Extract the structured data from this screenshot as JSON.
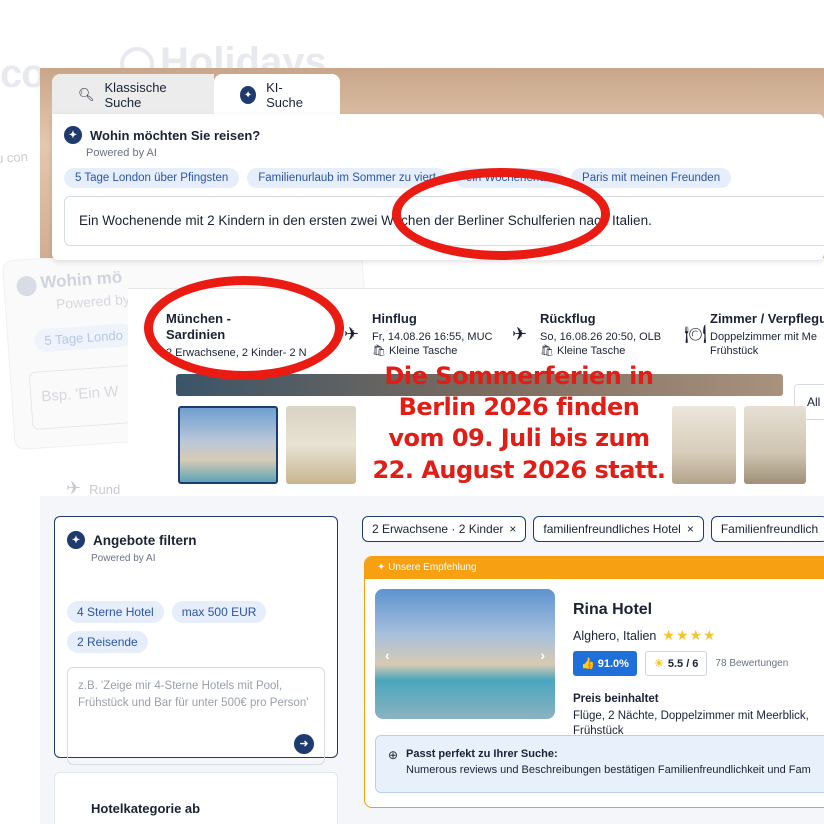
{
  "background": {
    "logo_left": "co",
    "logo_main": "Holidays",
    "side_text": "u con",
    "card_title": "Wohin mö",
    "card_sub": "Powered by",
    "card_chip": "5 Tage Londo",
    "card_input": "Bsp. 'Ein W",
    "rund_text": "Rund"
  },
  "search_tabs": [
    {
      "label": "Klassische Suche",
      "icon": "search-icon"
    },
    {
      "label": "KI-Suche",
      "icon": "ai-sparkle-icon"
    }
  ],
  "ai_search": {
    "title": "Wohin möchten Sie reisen?",
    "subtitle": "Powered by AI",
    "suggestions": [
      "5 Tage London über Pfingsten",
      "Familienurlaub im Sommer zu viert",
      "ein Wochenende",
      "Paris mit meinen Freunden"
    ],
    "query": "Ein Wochenende mit 2 Kindern in den ersten zwei Wochen der Berliner Schulferien nach Italien."
  },
  "trip": {
    "route": "München - Sardinien",
    "travellers": "2 Erwachsene, 2 Kinder- 2 N",
    "outbound": {
      "title": "Hinflug",
      "time": "Fr, 14.08.26 16:55, MUC",
      "baggage": "Kleine Tasche"
    },
    "return": {
      "title": "Rückflug",
      "time": "So, 16.08.26 20:50, OLB",
      "baggage": "Kleine Tasche"
    },
    "room": {
      "title": "Zimmer / Verpflegu",
      "text": "Doppelzimmer mit Me Frühstück"
    },
    "all_button": "All"
  },
  "annotation": "Die Sommerferien in Berlin 2026 finden vom 09. Juli bis zum 22. August 2026 statt.",
  "filter_panel": {
    "title": "Angebote filtern",
    "subtitle": "Powered by AI",
    "chips": [
      "4 Sterne Hotel",
      "max 500 EUR",
      "2 Reisende"
    ],
    "placeholder": "z.B. 'Zeige mir 4-Sterne Hotels mit Pool, Frühstück und Bar für unter 500€ pro Person'",
    "category_title": "Hotelkategorie ab"
  },
  "active_filters": [
    "2 Erwachsene · 2 Kinder",
    "familienfreundliches Hotel",
    "Familienfreundlich"
  ],
  "hotel": {
    "badge": "Unsere Empfehlung",
    "name": "Rina Hotel",
    "location": "Alghero, Italien",
    "stars": 4,
    "recommend_pct": "91.0%",
    "score": "5.5 / 6",
    "reviews": "78 Bewertungen",
    "price_heading": "Preis beinhaltet",
    "price_text": "Flüge, 2 Nächte, Doppelzimmer mit Meerblick, Frühstück",
    "fit_heading": "Passt perfekt zu Ihrer Suche:",
    "fit_text": "Numerous reviews und Beschreibungen bestätigen Familienfreundlichkeit und Fam"
  },
  "colors": {
    "accent": "#1e3a6e",
    "chip_bg": "#e6eefb",
    "annotation": "#e11d16",
    "recommendation": "#f7a011"
  }
}
